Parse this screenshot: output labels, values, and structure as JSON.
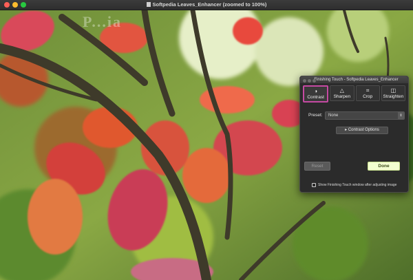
{
  "window": {
    "title": "Softpedia Leaves_Enhancer (zoomed to 100%)"
  },
  "canvas": {
    "watermark": "P...ia"
  },
  "panel": {
    "title": "Finishing Touch - Softpedia Leaves_Enhancer",
    "tools": [
      {
        "label": "Contrast",
        "icon": "contrast-icon",
        "active": true
      },
      {
        "label": "Sharpen",
        "icon": "sharpen-icon",
        "active": false
      },
      {
        "label": "Crop",
        "icon": "crop-icon",
        "active": false
      },
      {
        "label": "Straighten",
        "icon": "straighten-icon",
        "active": false
      }
    ],
    "preset_label": "Preset:",
    "preset_value": "None",
    "options_button": "Contrast Options",
    "reset_button": "Reset",
    "done_button": "Done",
    "checkbox_label": "Show Finishing Touch window after adjusting image",
    "checkbox_checked": false
  },
  "colors": {
    "active_tool_border": "#c64aa3",
    "done_button_bg": "#f2ffd0"
  }
}
